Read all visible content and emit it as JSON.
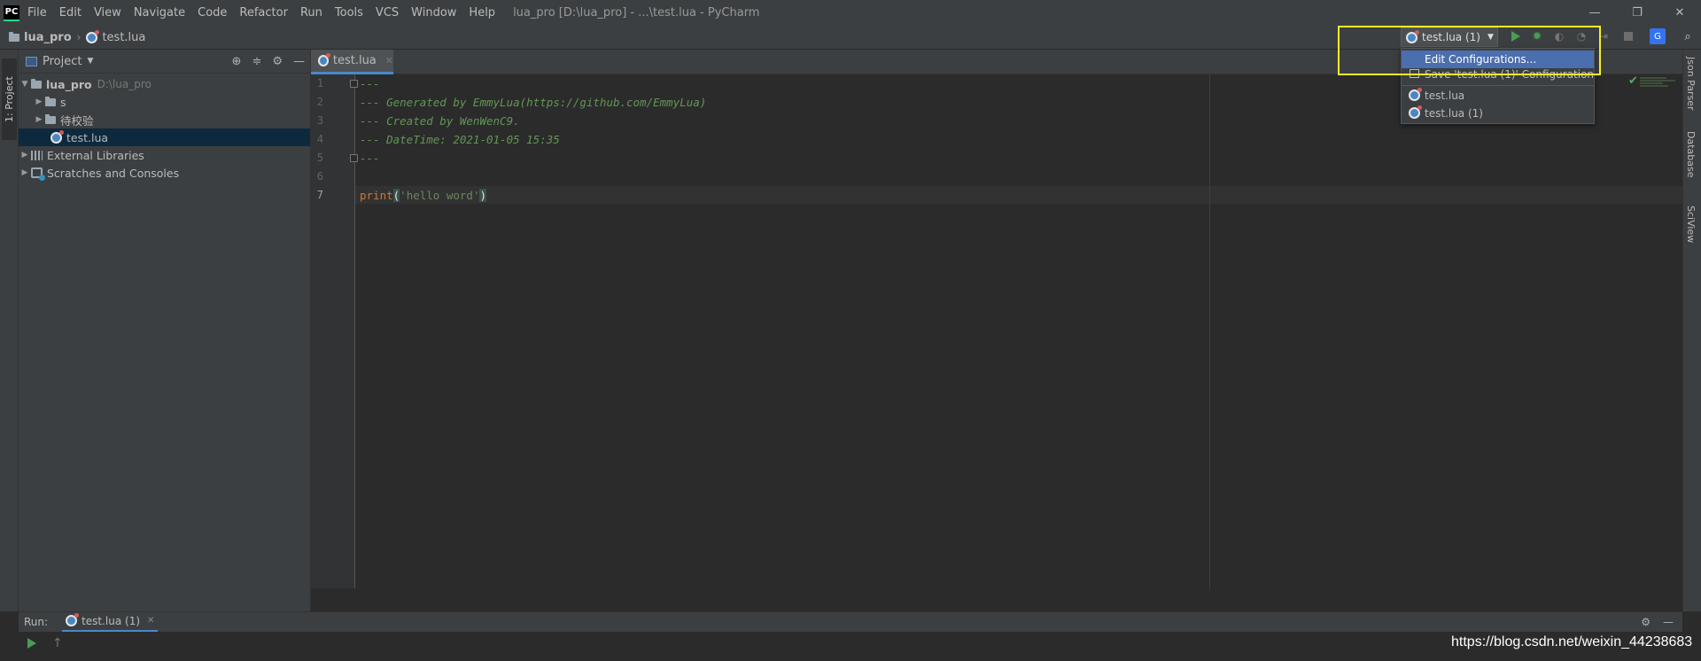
{
  "window": {
    "logo": "PC",
    "title": "lua_pro [D:\\lua_pro] - ...\\test.lua - PyCharm",
    "menu": [
      "File",
      "Edit",
      "View",
      "Navigate",
      "Code",
      "Refactor",
      "Run",
      "Tools",
      "VCS",
      "Window",
      "Help"
    ],
    "controls": {
      "minimize": "—",
      "restore": "❐",
      "close": "✕"
    }
  },
  "navbar": {
    "project": "lua_pro",
    "file": "test.lua"
  },
  "left_tool": {
    "project_tab": "1: Project"
  },
  "right_tool": {
    "json_parser": "Json Parser",
    "database": "Database",
    "sciview": "SciView"
  },
  "project_panel": {
    "title": "Project",
    "tree": [
      {
        "label": "lua_pro",
        "hint": "D:\\lua_pro"
      },
      {
        "label": "s"
      },
      {
        "label": "待校验"
      },
      {
        "label": "test.lua"
      },
      {
        "label": "External Libraries"
      },
      {
        "label": "Scratches and Consoles"
      }
    ]
  },
  "editor": {
    "tab": "test.lua",
    "line_numbers": [
      "1",
      "2",
      "3",
      "4",
      "5",
      "6",
      "7"
    ],
    "lines": {
      "l1": "---",
      "l2": "--- Generated by EmmyLua(https://github.com/EmmyLua)",
      "l3": "--- Created by WenWenC9.",
      "l4": "--- DateTime: 2021-01-05 15:35",
      "l5": "---",
      "l7_func": "print",
      "l7_open": "(",
      "l7_str": "'hello word'",
      "l7_close": ")"
    }
  },
  "run_config": {
    "selected": "test.lua (1)",
    "dropdown": {
      "edit": "Edit Configurations...",
      "save": "Save 'test.lua (1)' Configuration",
      "items": [
        "test.lua",
        "test.lua (1)"
      ]
    }
  },
  "run_panel": {
    "label": "Run:",
    "tab": "test.lua (1)"
  },
  "watermark": "https://blog.csdn.net/weixin_44238683",
  "colors": {
    "highlight_box": "#f2ee2a",
    "selection": "#4b6eaf",
    "run_green": "#499c54"
  }
}
